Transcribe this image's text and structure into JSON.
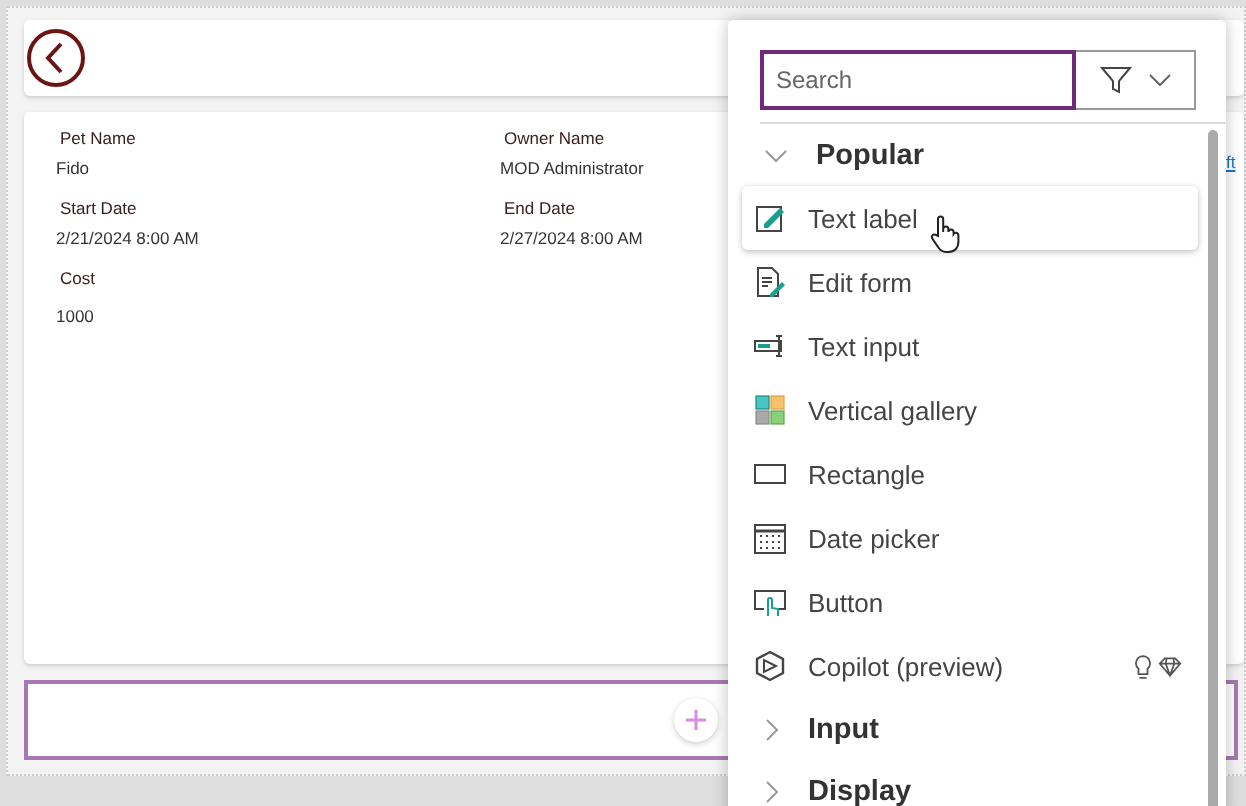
{
  "form": {
    "fields": [
      {
        "label": "Pet Name",
        "value": "Fido"
      },
      {
        "label": "Owner Name",
        "value": "MOD Administrator"
      },
      {
        "label": "Start Date",
        "value": "2/21/2024 8:00 AM"
      },
      {
        "label": "End Date",
        "value": "2/27/2024 8:00 AM"
      },
      {
        "label": "Cost",
        "value": "1000"
      }
    ],
    "link": "ft"
  },
  "insert_panel": {
    "search": {
      "placeholder": "Search"
    },
    "categories": [
      {
        "name": "Popular",
        "expanded": true,
        "items": [
          {
            "label": "Text label",
            "selected": true,
            "premium": false
          },
          {
            "label": "Edit form",
            "selected": false,
            "premium": false
          },
          {
            "label": "Text input",
            "selected": false,
            "premium": false
          },
          {
            "label": "Vertical gallery",
            "selected": false,
            "premium": false
          },
          {
            "label": "Rectangle",
            "selected": false,
            "premium": false
          },
          {
            "label": "Date picker",
            "selected": false,
            "premium": false
          },
          {
            "label": "Button",
            "selected": false,
            "premium": false
          },
          {
            "label": "Copilot (preview)",
            "selected": false,
            "premium": true
          }
        ]
      },
      {
        "name": "Input",
        "expanded": false
      },
      {
        "name": "Display",
        "expanded": false
      }
    ]
  }
}
